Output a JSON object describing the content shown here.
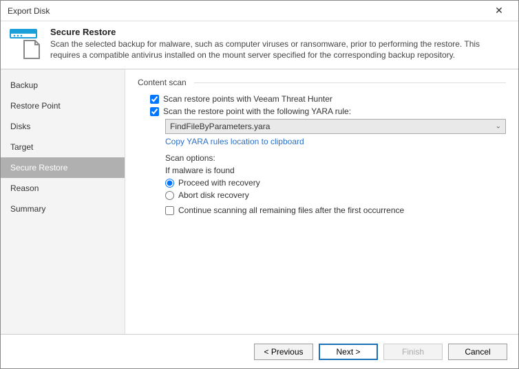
{
  "window": {
    "title": "Export Disk"
  },
  "header": {
    "title": "Secure Restore",
    "description": "Scan the selected backup for malware, such as computer viruses or ransomware, prior to performing the restore. This requires a compatible antivirus installed on the mount server specified for the corresponding backup repository."
  },
  "sidebar": {
    "items": [
      {
        "label": "Backup"
      },
      {
        "label": "Restore Point"
      },
      {
        "label": "Disks"
      },
      {
        "label": "Target"
      },
      {
        "label": "Secure Restore",
        "selected": true
      },
      {
        "label": "Reason"
      },
      {
        "label": "Summary"
      }
    ]
  },
  "content": {
    "group_label": "Content scan",
    "scan_threat_hunter": {
      "label": "Scan restore points with Veeam Threat Hunter",
      "checked": true
    },
    "scan_yara": {
      "label": "Scan the restore point with the following YARA rule:",
      "checked": true
    },
    "yara_dropdown": {
      "value": "FindFileByParameters.yara"
    },
    "copy_link": "Copy YARA rules location to clipboard",
    "scan_options_label": "Scan options:",
    "malware_found_label": "If malware is found",
    "radio_proceed": {
      "label": "Proceed with recovery",
      "checked": true
    },
    "radio_abort": {
      "label": "Abort disk recovery",
      "checked": false
    },
    "continue_scan": {
      "label": "Continue scanning all remaining files after the first occurrence",
      "checked": false
    }
  },
  "footer": {
    "previous": "< Previous",
    "next": "Next >",
    "finish": "Finish",
    "cancel": "Cancel"
  },
  "colors": {
    "accent": "#1a6fb5",
    "link": "#2a6fc9"
  }
}
